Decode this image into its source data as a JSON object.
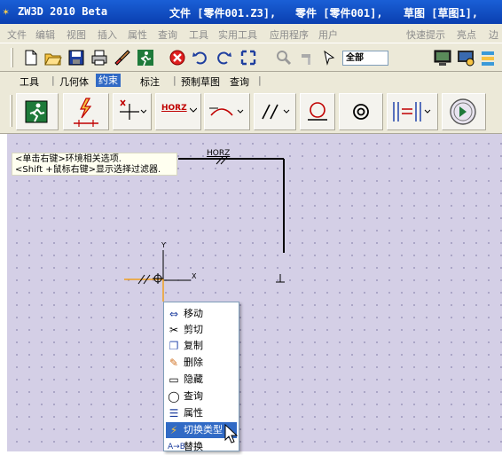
{
  "window": {
    "app_title": "ZW3D 2010 Beta",
    "file_info": "文件 [零件001.Z3],",
    "part_info": "零件 [零件001],",
    "sketch_info": "草图 [草图1],"
  },
  "menubar": {
    "items": [
      "文件",
      "编辑",
      "视图",
      "插入",
      "属性",
      "查询",
      "工具",
      "实用工具",
      "应用程序",
      "用户"
    ],
    "right_items": [
      "快速提示",
      "亮点",
      "边"
    ]
  },
  "toolbar": {
    "filter_value": "全部",
    "icons": [
      "new-file-icon",
      "open-folder-icon",
      "save-icon",
      "print-icon",
      "brush-icon",
      "exit-icon",
      "stop-icon",
      "undo-icon",
      "redo-icon",
      "transform-icon",
      "tools-icon",
      "hammer-icon",
      "pointer-icon",
      "monitor-icon",
      "monitor-settings-icon",
      "layers-icon"
    ]
  },
  "tabs": {
    "items": [
      "工具",
      "几何体",
      "约束",
      "标注",
      "预制草图",
      "查询"
    ],
    "selected": "约束"
  },
  "command_toolbar": {
    "horz_label": "HORZ",
    "icons": [
      "exit-sketch-icon",
      "dimension-origin-icon",
      "point-constraint-icon",
      "horizontal-constraint-icon",
      "tangent-constraint-icon",
      "parallel-constraint-icon",
      "on-curve-constraint-icon",
      "concentric-constraint-icon",
      "equal-constraint-icon",
      "constraint-status-icon"
    ]
  },
  "canvas": {
    "hint_line1": "<单击右键>环境相关选项.",
    "hint_line2": "<Shift +鼠标右键>显示选择过滤器.",
    "horz_label": "HORZ",
    "axis_x": "X",
    "axis_y": "Y",
    "background_color": "#d4cfe6"
  },
  "context_menu": {
    "items": [
      {
        "label": "移动",
        "icon": "move-icon"
      },
      {
        "label": "剪切",
        "icon": "scissors-icon"
      },
      {
        "label": "复制",
        "icon": "copy-icon"
      },
      {
        "label": "删除",
        "icon": "eraser-icon"
      },
      {
        "label": "隐藏",
        "icon": "hide-icon"
      },
      {
        "label": "查询",
        "icon": "query-icon"
      },
      {
        "label": "属性",
        "icon": "properties-icon"
      },
      {
        "label": "切换类型",
        "icon": "toggle-type-icon"
      },
      {
        "label": "替换",
        "icon": "replace-icon"
      }
    ],
    "highlighted": "切换类型"
  }
}
